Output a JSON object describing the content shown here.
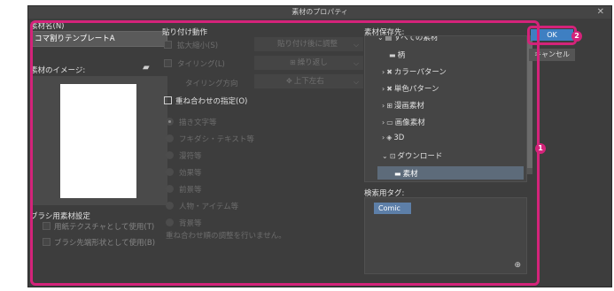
{
  "window": {
    "title": "素材のプロパティ",
    "close_icon": "close-icon"
  },
  "left": {
    "name_label": "素材名(N)",
    "name_value": "コマ割りテンプレートA",
    "image_label": "素材のイメージ:",
    "brush_section_label": "ブラシ用素材設定",
    "use_as_paper_texture": "用紙テクスチャとして使用(T)",
    "use_as_brush_tip": "ブラシ先端形状として使用(B)"
  },
  "paste": {
    "section_label": "貼り付け動作",
    "scale_label": "拡大縮小(S)",
    "scale_option": "貼り付け後に調整",
    "tiling_label": "タイリング(L)",
    "tiling_option": "繰り返し",
    "tiling_direction_label": "タイリング方向",
    "tiling_direction_option": "上下左右",
    "overlay_label": "重ね合わせの指定(O)",
    "overlay_options": [
      "描き文字等",
      "フキダシ・テキスト等",
      "漫符等",
      "効果等",
      "前景等",
      "人物・アイテム等",
      "背景等"
    ],
    "overlay_note": "重ね合わせ順の調整を行いません。"
  },
  "save_location": {
    "label": "素材保存先:",
    "items": [
      "すべての素材",
      "柄",
      "カラーパターン",
      "単色パターン",
      "漫画素材",
      "画像素材",
      "3D",
      "ダウンロード",
      "素材"
    ],
    "selected": "素材"
  },
  "search_tags": {
    "label": "検索用タグ:",
    "tags": [
      "Comic"
    ]
  },
  "buttons": {
    "ok": "OK",
    "cancel": "キャンセル"
  },
  "callouts": [
    "1",
    "2"
  ],
  "colors": {
    "accent": "#d4237a",
    "ok_button": "#3e7fc2",
    "selection": "#5d6b7a",
    "tag": "#5d7fa8"
  }
}
